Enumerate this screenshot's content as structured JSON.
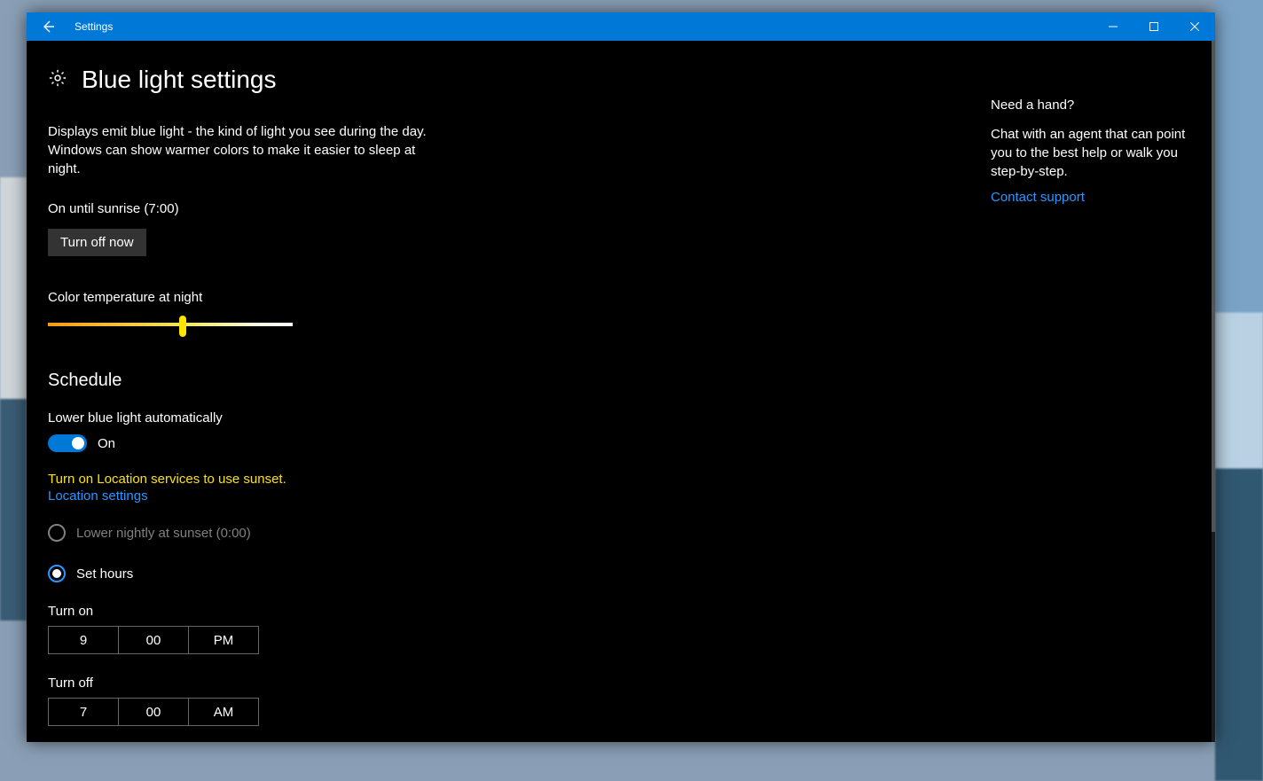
{
  "titlebar": {
    "app_name": "Settings"
  },
  "page": {
    "title": "Blue light settings",
    "description": "Displays emit blue light - the kind of light you see during the day. Windows can show warmer colors to make it easier to sleep at night.",
    "status": "On until sunrise (7:00)",
    "turn_off_label": "Turn off now",
    "color_temp_label": "Color temperature at night"
  },
  "schedule": {
    "heading": "Schedule",
    "auto_label": "Lower blue light automatically",
    "toggle_state": "On",
    "warning": "Turn on Location services to use sunset.",
    "location_link": "Location settings",
    "option_sunset": "Lower nightly at sunset (0:00)",
    "option_set_hours": "Set hours",
    "turn_on_label": "Turn on",
    "turn_on": {
      "hour": "9",
      "minute": "00",
      "period": "PM"
    },
    "turn_off_label": "Turn off",
    "turn_off": {
      "hour": "7",
      "minute": "00",
      "period": "AM"
    }
  },
  "help": {
    "title": "Need a hand?",
    "desc": "Chat with an agent that can point you to the best help or walk you step-by-step.",
    "link": "Contact support"
  }
}
